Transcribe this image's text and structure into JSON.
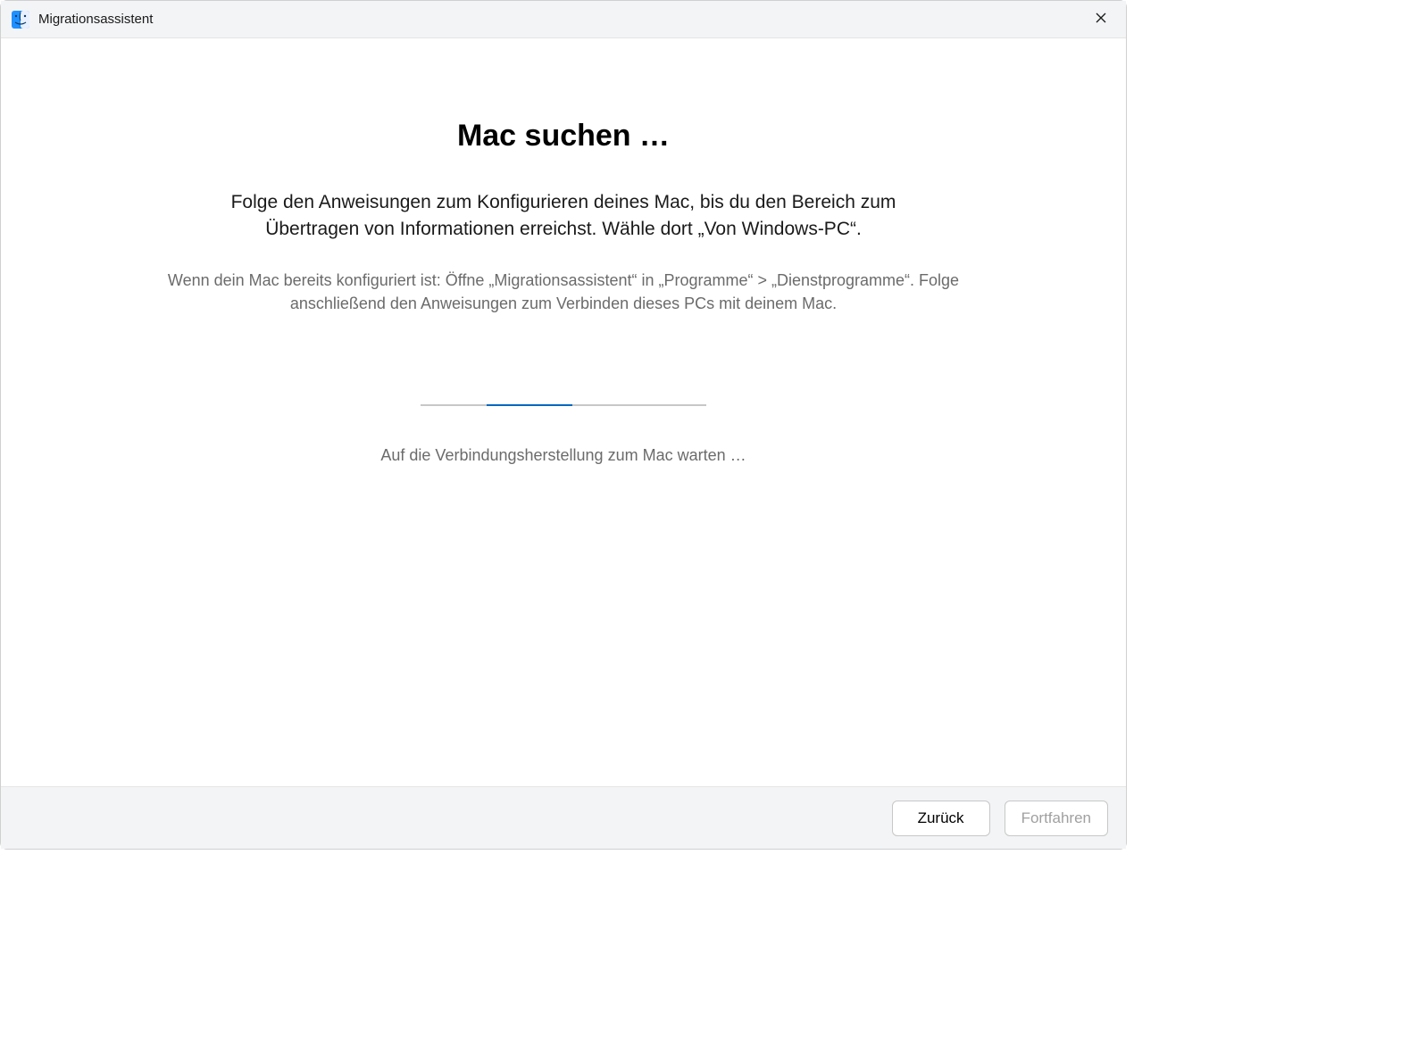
{
  "titlebar": {
    "title": "Migrationsassistent"
  },
  "main": {
    "heading": "Mac suchen …",
    "primary_text": "Folge den Anweisungen zum Konfigurieren deines Mac, bis du den Bereich zum Übertragen von Informationen erreichst. Wähle dort „Von Windows-PC“.",
    "secondary_text": "Wenn dein Mac bereits konfiguriert ist: Öffne „Migrationsassistent“ in „Programme“ > „Dienstprogramme“. Folge anschließend den Anweisungen zum Verbinden dieses PCs mit deinem Mac.",
    "status_text": "Auf die Verbindungsherstellung zum Mac warten …"
  },
  "footer": {
    "back_label": "Zurück",
    "continue_label": "Fortfahren"
  }
}
